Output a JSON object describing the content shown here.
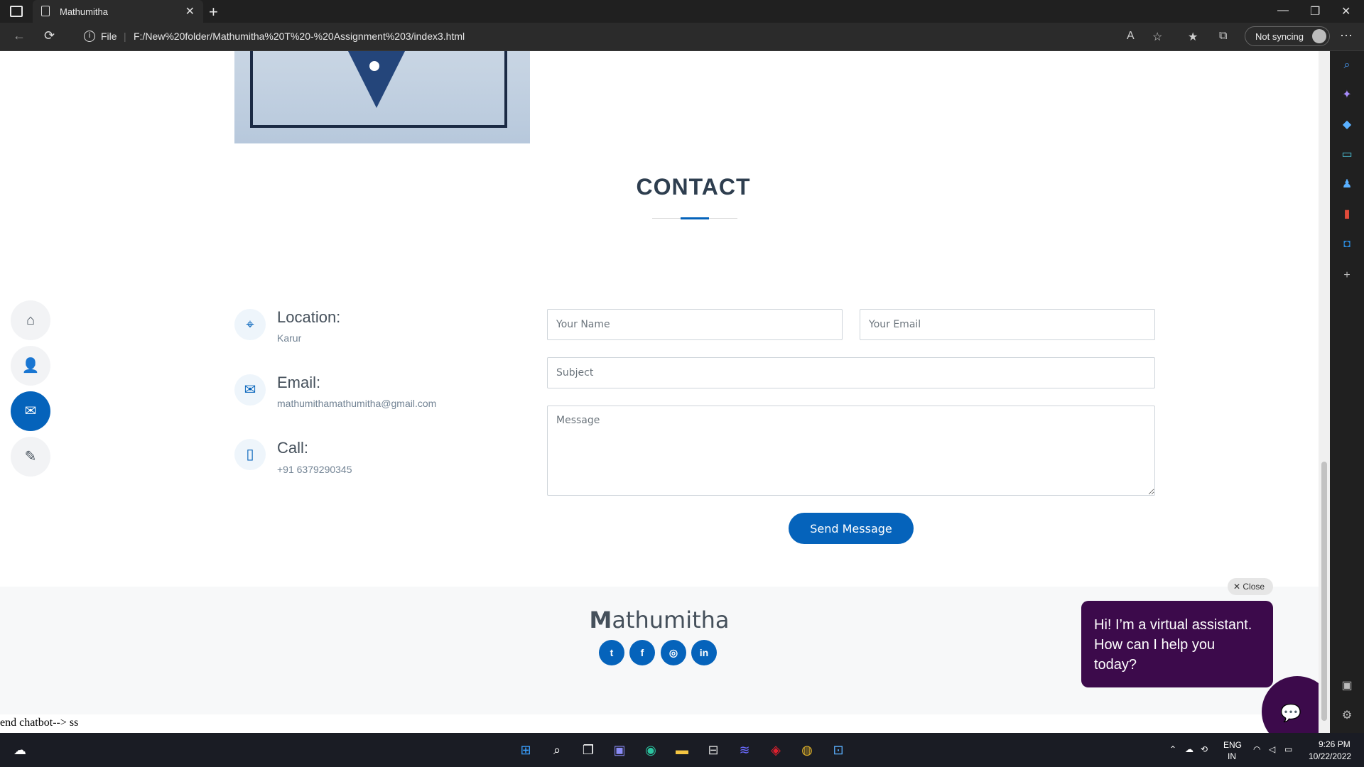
{
  "browser": {
    "tab_title": "Mathumitha",
    "protocol_label": "File",
    "url": "F:/New%20folder/Mathumitha%20T%20-%20Assignment%203/index3.html",
    "sync_label": "Not syncing"
  },
  "contact": {
    "heading": "CONTACT",
    "location_title": "Location:",
    "location_value": "Karur",
    "email_title": "Email:",
    "email_value": "mathumithamathumitha@gmail.com",
    "call_title": "Call:",
    "call_value": "+91 6379290345"
  },
  "form": {
    "name_placeholder": "Your Name",
    "email_placeholder": "Your Email",
    "subject_placeholder": "Subject",
    "message_placeholder": "Message",
    "send_label": "Send Message"
  },
  "footer": {
    "brand_initial": "M",
    "brand_rest": "athumitha",
    "social": [
      "twitter-icon",
      "facebook-icon",
      "instagram-icon",
      "linkedin-icon"
    ]
  },
  "chatbot": {
    "close_label": "Close",
    "message": "Hi! I’m a virtual assistant. How can I help you today?"
  },
  "page_tail_text": "end chatbot--> ss",
  "taskbar": {
    "lang_1": "ENG",
    "lang_2": "IN",
    "time": "9:26 PM",
    "date": "10/22/2022"
  },
  "colors": {
    "accent": "#0563bb",
    "chat_purple": "#3c0a4b"
  }
}
